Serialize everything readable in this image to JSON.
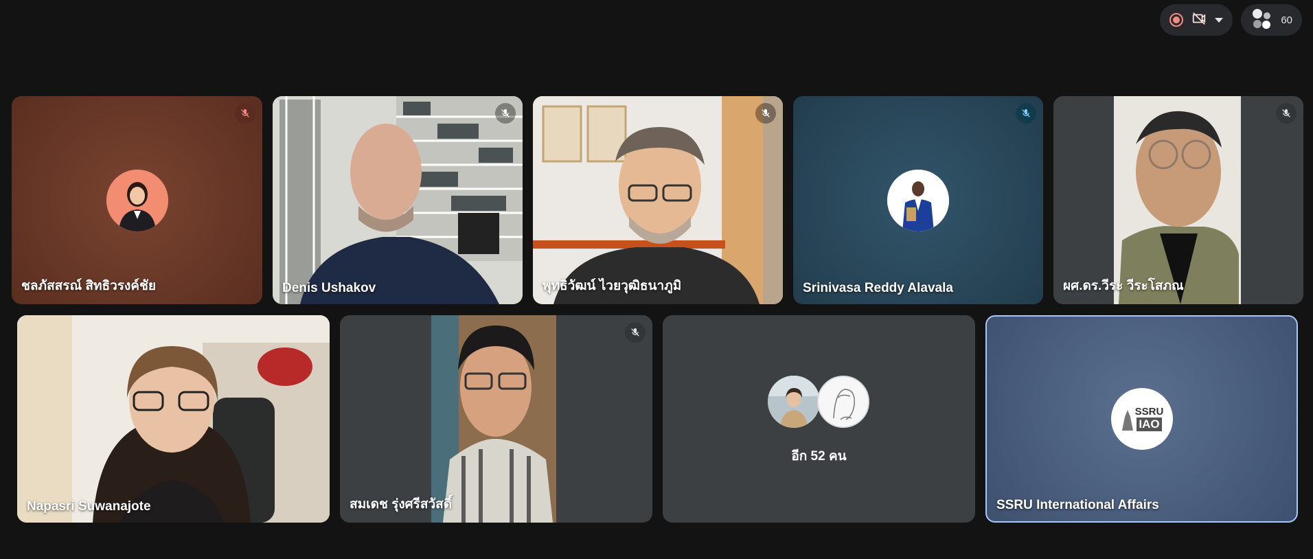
{
  "toolbar": {
    "participant_count": "60",
    "recording_color": "#f28b82"
  },
  "tiles_row1": [
    {
      "name": "ชลภัสสรณ์ สิทธิวรงค์ชัย",
      "muted": true,
      "mute_style": "red",
      "bg": "#6e3a2a"
    },
    {
      "name": "Denis Ushakov",
      "muted": true
    },
    {
      "name": "พุทธิวัฒน์ ไวยวุฒิธนาภูมิ",
      "muted": true
    },
    {
      "name": "Srinivasa Reddy Alavala",
      "muted": true,
      "mute_style": "blue",
      "bg": "#2b4a5c"
    },
    {
      "name": "ผศ.ดร.วีระ วีระโสภณ",
      "muted": true
    }
  ],
  "tiles_row2": [
    {
      "name": "Napasri Suwanajote",
      "muted": false
    },
    {
      "name": "สมเดช รุ่งศรีสวัสดิ์",
      "muted": true
    },
    {
      "group_label": "อีก 52 คน"
    },
    {
      "name": "SSRU International Affairs",
      "logo_text_top": "SSRU",
      "logo_text_bottom": "IAO",
      "active_speaker": true,
      "border_color": "#a8c7fa"
    }
  ]
}
